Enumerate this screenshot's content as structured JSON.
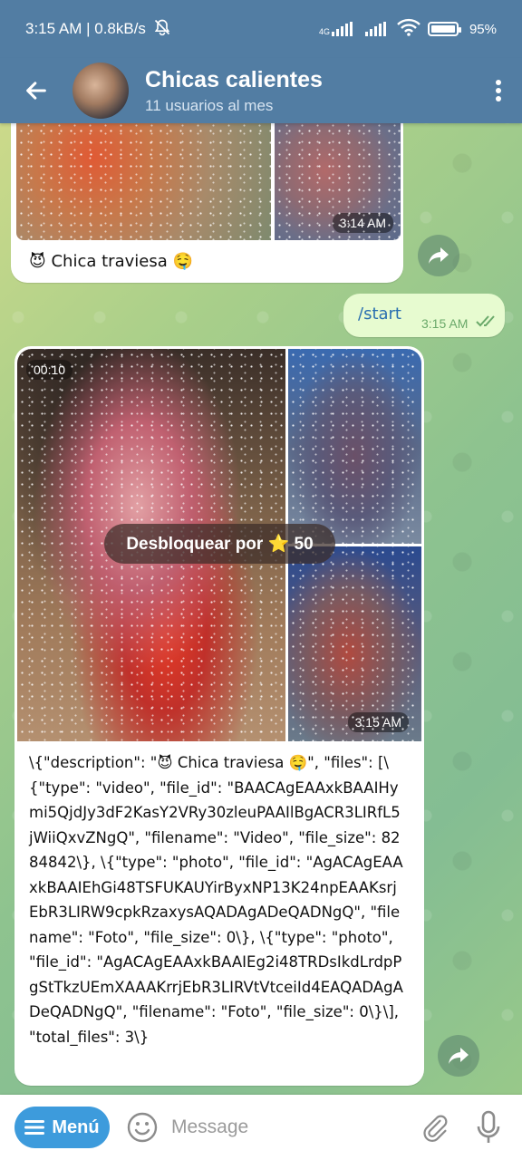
{
  "status_bar": {
    "time_speed": "3:15 AM | 0.8kB/s",
    "network_label": "4G",
    "battery": "95%"
  },
  "header": {
    "title": "Chicas calientes",
    "subtitle": "11 usuarios al mes"
  },
  "messages": {
    "first": {
      "time": "3:14 AM",
      "caption": "😈 Chica traviesa 🤤"
    },
    "outgoing": {
      "text": "/start",
      "time": "3:15 AM"
    },
    "second": {
      "video_duration": "00:10",
      "unlock_label": "Desbloquear por ⭐ 50",
      "time": "3:15 AM",
      "json_text": "\\{\"description\": \"😈 Chica traviesa 🤤\", \"files\": [\\{\"type\": \"video\", \"file_id\": \"BAACAgEAAxkBAAIHymi5QjdJy3dF2KasY2VRy30zleuPAAIlBgACR3LIRfL5jWiiQxvZNgQ\", \"filename\": \"Video\", \"file_size\": 8284842\\}, \\{\"type\": \"photo\", \"file_id\": \"AgACAgEAAxkBAAIEhGi48TSFUKAUYirByxNP13K24npEAAKsrjEbR3LIRW9cpkRzaxysAQADAgADeQADNgQ\", \"filename\": \"Foto\", \"file_size\": 0\\}, \\{\"type\": \"photo\", \"file_id\": \"AgACAgEAAxkBAAIEg2i48TRDsIkdLrdpPgStTkzUEmXAAAKrrjEbR3LIRVtVtceiId4EAQADAgADeQADNgQ\", \"filename\": \"Foto\", \"file_size\": 0\\}\\], \"total_files\": 3\\}"
    }
  },
  "input_bar": {
    "menu_label": "Menú",
    "placeholder": "Message"
  },
  "colors": {
    "header_bg": "#527da3",
    "menu_button": "#3d9bdc",
    "outgoing_bubble": "#e7fbd0"
  }
}
